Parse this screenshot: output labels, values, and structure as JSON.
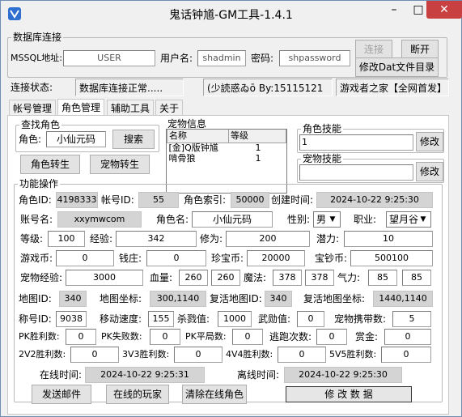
{
  "window": {
    "title": "鬼话钟馗-GM工具-1.4.1",
    "minimize": "–",
    "maximize": "□",
    "close": "✕"
  },
  "db": {
    "group_label": "数据库连接",
    "addr_label": "MSSQL地址:",
    "addr_value": "USER",
    "user_label": "用户名:",
    "user_value": "shadmin",
    "pwd_label": "密码:",
    "pwd_value": "shpassword",
    "connect_btn": "连接",
    "disconnect_btn": "断开",
    "edit_dat_btn": "修改Dat文件目录"
  },
  "status": {
    "label": "连接状态:",
    "value": "数据库连接正常.....",
    "author": "(少読惑ゐō By:15115121",
    "site": "游戏者之家【全网首发】"
  },
  "tabs": [
    {
      "label": "帐号管理"
    },
    {
      "label": "角色管理"
    },
    {
      "label": "辅助工具"
    },
    {
      "label": "关于"
    }
  ],
  "search": {
    "group_label": "查找角色",
    "role_label": "角色:",
    "role_value": "小仙元码",
    "search_btn": "搜索",
    "reincarnate_btn": "角色转生",
    "pet_reincarnate_btn": "宠物转生"
  },
  "pet_info": {
    "group_label": "宠物信息",
    "columns": [
      "名称",
      "等级"
    ],
    "rows": [
      [
        "[金]Q版钟馗",
        "1"
      ],
      [
        "啃骨狼",
        "1"
      ]
    ]
  },
  "role_skill": {
    "group_label": "角色技能",
    "value": "1",
    "btn": "修改"
  },
  "pet_skill": {
    "group_label": "宠物技能",
    "value": "",
    "btn": "修改"
  },
  "func": {
    "group_label": "功能操作",
    "role_id_label": "角色ID:",
    "role_id": "4198333",
    "account_id_label": "帐号ID:",
    "account_id": "55",
    "role_index_label": "角色索引:",
    "role_index": "50000",
    "create_time_label": "创建时间:",
    "create_time": "2024-10-22 9:25:30",
    "account_name_label": "账号名:",
    "account_name": "xxymwcom",
    "role_name_label": "角色名:",
    "role_name": "小仙元码",
    "gender_label": "性别:",
    "gender": "男",
    "job_label": "职业:",
    "job": "望月谷",
    "level_label": "等级:",
    "level": "100",
    "exp_label": "经验:",
    "exp": "342",
    "cultivation_label": "修为:",
    "cultivation": "200",
    "potential_label": "潜力:",
    "potential": "10",
    "game_coin_label": "游戏币:",
    "game_coin": "0",
    "bank_label": "钱庄:",
    "bank": "0",
    "gold_label": "珍宝币:",
    "gold": "20000",
    "treasure_label": "宝钞币:",
    "treasure": "500100",
    "pet_exp_label": "宠物经验:",
    "pet_exp": "3000",
    "hp_label": "血量:",
    "hp_cur": "260",
    "hp_max": "260",
    "mp_label": "魔法:",
    "mp_cur": "378",
    "mp_max": "378",
    "qi_label": "气力:",
    "qi_cur": "85",
    "qi_max": "85",
    "map_id_label": "地图ID:",
    "map_id": "340",
    "map_coord_label": "地图坐标:",
    "map_coord": "300,1140",
    "revive_map_id_label": "复活地图ID:",
    "revive_map_id": "340",
    "revive_coord_label": "复活地图坐标:",
    "revive_coord": "1440,1140",
    "title_id_label": "称号ID:",
    "title_id": "9038",
    "speed_label": "移动速度:",
    "speed": "155",
    "pk_value_label": "杀戮值:",
    "pk_value": "1000",
    "merit_label": "武勋值:",
    "merit": "0",
    "pet_carry_label": "宠物携带数:",
    "pet_carry": "5",
    "pk_win_label": "PK胜利数:",
    "pk_win": "0",
    "pk_lose_label": "PK失败数:",
    "pk_lose": "0",
    "pk_draw_label": "PK平局数:",
    "pk_draw": "0",
    "escape_label": "逃跑次数:",
    "escape": "0",
    "reward_label": "赏金:",
    "reward": "0",
    "w2v2_label": "2V2胜利数:",
    "w2v2": "0",
    "w3v3_label": "3V3胜利数:",
    "w3v3": "0",
    "w4v4_label": "4V4胜利数:",
    "w4v4": "0",
    "w5v5_label": "5V5胜利数:",
    "w5v5": "0",
    "online_label": "在线时间:",
    "online": "2024-10-22 9:25:31",
    "offline_label": "离线时间:",
    "offline": "2024-10-22 9:25:30",
    "send_mail_btn": "发送邮件",
    "online_players_btn": "在线的玩家",
    "clear_online_btn": "清除在线角色",
    "modify_btn": "修 改 数 据"
  }
}
